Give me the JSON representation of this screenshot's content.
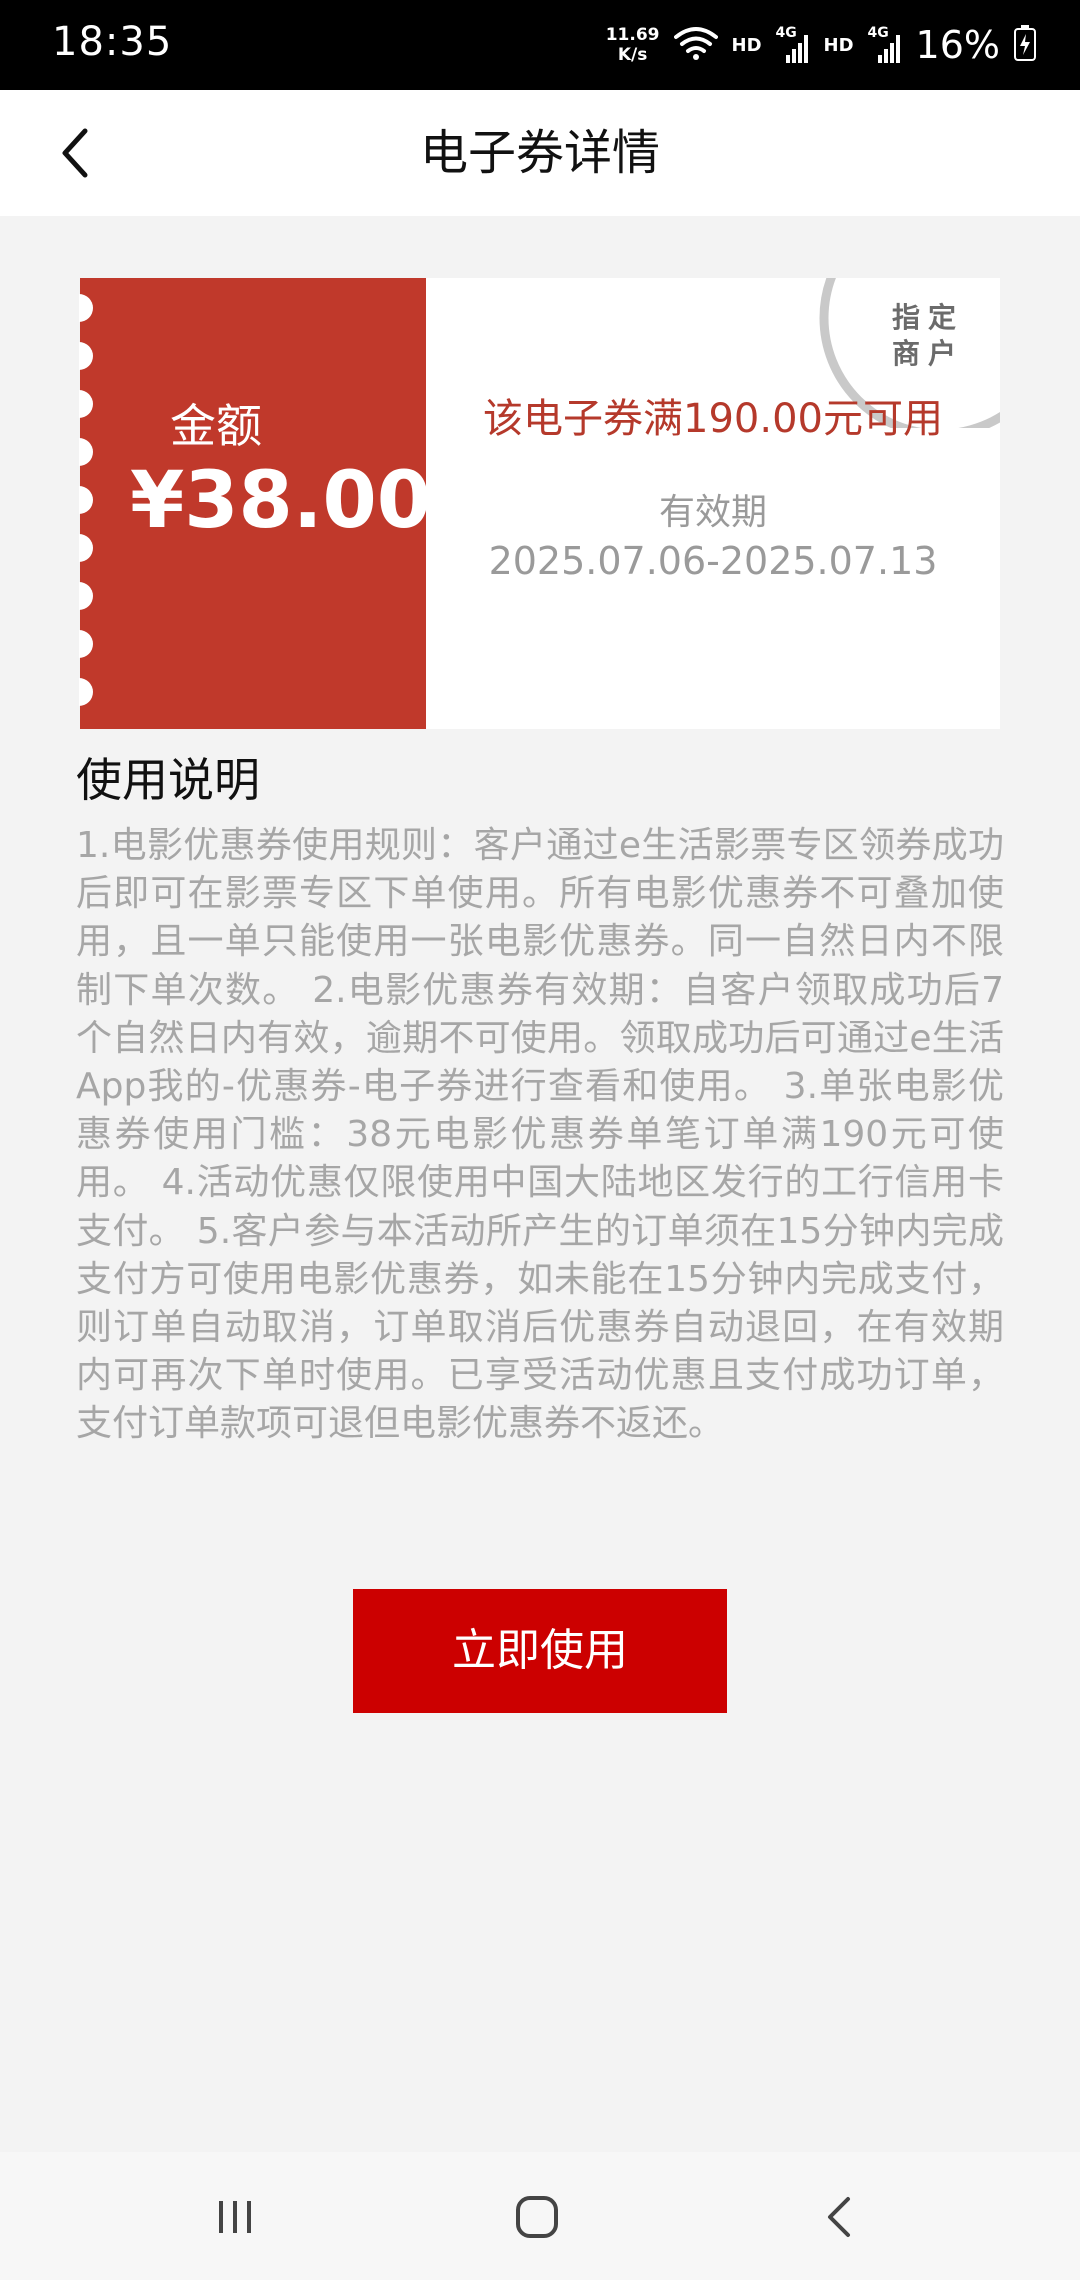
{
  "status_bar": {
    "time": "18:35",
    "net_speed_value": "11.69",
    "net_speed_unit": "K/s",
    "hd1": "HD",
    "hd2": "HD",
    "sig1": "4G",
    "sig2": "4G",
    "battery": "16%",
    "icons": [
      "wifi-icon",
      "signal-icon",
      "battery-icon"
    ]
  },
  "header": {
    "title": "电子券详情",
    "back_icon": "chevron-left-icon"
  },
  "coupon": {
    "amount_label": "金额",
    "amount_value": "¥38.00",
    "condition": "该电子券满190.00元可用",
    "validity_label": "有效期",
    "validity_range": "2025.07.06-2025.07.13",
    "stamp_text": "指定商户",
    "colors": {
      "left_bg": "#c0392b",
      "condition_text": "#b5392b"
    }
  },
  "instructions": {
    "title": "使用说明",
    "body": "1.电影优惠券使用规则：客户通过e生活影票专区领券成功后即可在影票专区下单使用。所有电影优惠券不可叠加使用，且一单只能使用一张电影优惠券。同一自然日内不限制下单次数。 2.电影优惠券有效期：自客户领取成功后7个自然日内有效，逾期不可使用。领取成功后可通过e生活App我的-优惠券-电子券进行查看和使用。 3.单张电影优惠券使用门槛：38元电影优惠券单笔订单满190元可使用。 4.活动优惠仅限使用中国大陆地区发行的工行信用卡支付。 5.客户参与本活动所产生的订单须在15分钟内完成支付方可使用电影优惠券，如未能在15分钟内完成支付，则订单自动取消，订单取消后优惠券自动退回，在有效期内可再次下单时使用。已享受活动优惠且支付成功订单，支付订单款项可退但电影优惠券不返还。"
  },
  "actions": {
    "use_now": "立即使用",
    "button_color": "#cc0000"
  },
  "nav_bar": {
    "icons": [
      "recent-apps-icon",
      "home-icon",
      "back-icon"
    ]
  }
}
